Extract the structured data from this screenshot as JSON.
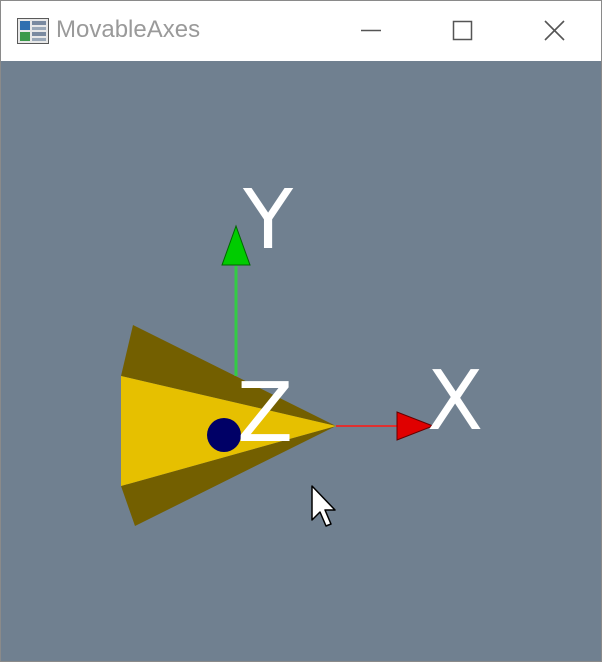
{
  "window": {
    "title": "MovableAxes",
    "icon": "app-window-icon",
    "controls": [
      {
        "name": "minimize",
        "icon": "minimize-icon"
      },
      {
        "name": "maximize",
        "icon": "maximize-icon"
      },
      {
        "name": "close",
        "icon": "close-icon"
      }
    ]
  },
  "scene": {
    "background": "#708090",
    "axes": {
      "x_label": "X",
      "y_label": "Y",
      "z_label": "Z",
      "x_color": "#ff0000",
      "y_color": "#00cc00",
      "z_color": "#000066"
    },
    "cone_color": "#e6c000",
    "cursor_icon": "mouse-pointer-icon"
  }
}
